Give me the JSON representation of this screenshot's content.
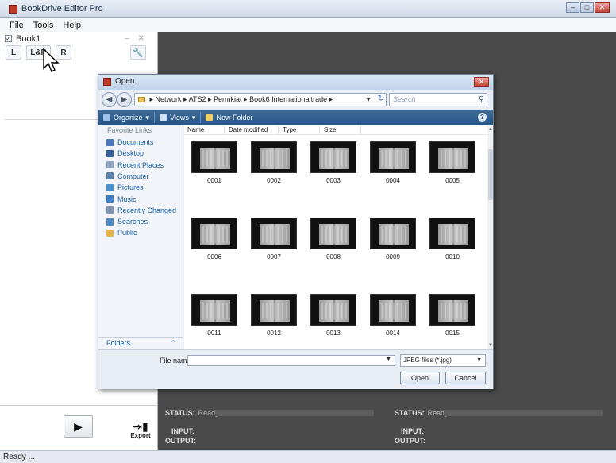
{
  "app": {
    "title": "BookDrive Editor Pro",
    "menu": [
      "File",
      "Tools",
      "Help"
    ],
    "document": {
      "title": "Book1",
      "checked": true,
      "mode_buttons": [
        "L",
        "L&R",
        "R"
      ]
    },
    "export_label": "Export",
    "status_left": {
      "status_label": "STATUS:",
      "status_value": "Ready",
      "input_label": "INPUT:",
      "input_value": "",
      "output_label": "OUTPUT:",
      "output_value": ""
    },
    "status_right": {
      "status_label": "STATUS:",
      "status_value": "Ready",
      "input_label": "INPUT:",
      "input_value": "",
      "output_label": "OUTPUT:",
      "output_value": ""
    },
    "statusbar": "Ready ..."
  },
  "dialog": {
    "title": "Open",
    "breadcrumb": [
      "Network",
      "ATS2",
      "Permkiat",
      "Book6 Internationaltrade"
    ],
    "search_placeholder": "Search",
    "toolbar": [
      "Organize",
      "Views",
      "New Folder"
    ],
    "favorites_heading": "Favorite Links",
    "favorites": [
      {
        "label": "Documents",
        "color": "#4a78b8"
      },
      {
        "label": "Desktop",
        "color": "#2f5f9e"
      },
      {
        "label": "Recent Places",
        "color": "#8fa6c4"
      },
      {
        "label": "Computer",
        "color": "#5a7fa8"
      },
      {
        "label": "Pictures",
        "color": "#4a8fc8"
      },
      {
        "label": "Music",
        "color": "#3d7fc0"
      },
      {
        "label": "Recently Changed",
        "color": "#7f95b3"
      },
      {
        "label": "Searches",
        "color": "#4d8ac6"
      },
      {
        "label": "Public",
        "color": "#e3b64c"
      }
    ],
    "folders_label": "Folders",
    "columns": [
      "Name",
      "Date modified",
      "Type",
      "Size"
    ],
    "files": [
      "0001",
      "0002",
      "0003",
      "0004",
      "0005",
      "0006",
      "0007",
      "0008",
      "0009",
      "0010",
      "0011",
      "0012",
      "0013",
      "0014",
      "0015"
    ],
    "file_name_label": "File name:",
    "file_name_value": "",
    "file_type": "JPEG files (*.jpg)",
    "open_button": "Open",
    "cancel_button": "Cancel"
  }
}
